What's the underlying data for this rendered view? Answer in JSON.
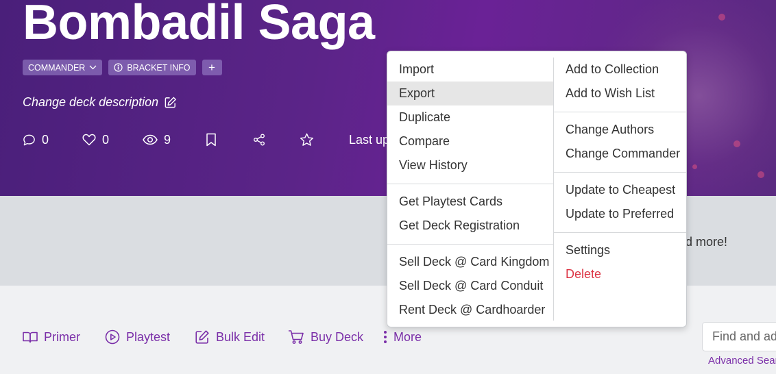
{
  "deck": {
    "title": "Bombadil Saga",
    "tags": {
      "format": "COMMANDER",
      "bracket": "BRACKET INFO",
      "add": "+"
    },
    "description": "Change deck description",
    "stats": {
      "comments": "0",
      "likes": "0",
      "views": "9"
    },
    "last_updated": "Last up"
  },
  "banner": {
    "text": "nd more!"
  },
  "toolbar": {
    "primer": "Primer",
    "playtest": "Playtest",
    "bulk_edit": "Bulk Edit",
    "buy_deck": "Buy Deck",
    "more": "More"
  },
  "search": {
    "placeholder": "Find and add cards",
    "advanced": "Advanced Search"
  },
  "menu": {
    "left": [
      [
        "Import",
        "Export",
        "Duplicate",
        "Compare",
        "View History"
      ],
      [
        "Get Playtest Cards",
        "Get Deck Registration"
      ],
      [
        "Sell Deck @ Card Kingdom",
        "Sell Deck @ Card Conduit",
        "Rent Deck @ Cardhoarder"
      ]
    ],
    "right": [
      [
        "Add to Collection",
        "Add to Wish List"
      ],
      [
        "Change Authors",
        "Change Commander"
      ],
      [
        "Update to Cheapest",
        "Update to Preferred"
      ],
      [
        "Settings",
        "Delete"
      ]
    ],
    "highlighted": "Export",
    "danger_item": "Delete"
  },
  "colors": {
    "accent": "#7a2ea8",
    "hero": "#5b2488",
    "danger": "#dc3545"
  }
}
